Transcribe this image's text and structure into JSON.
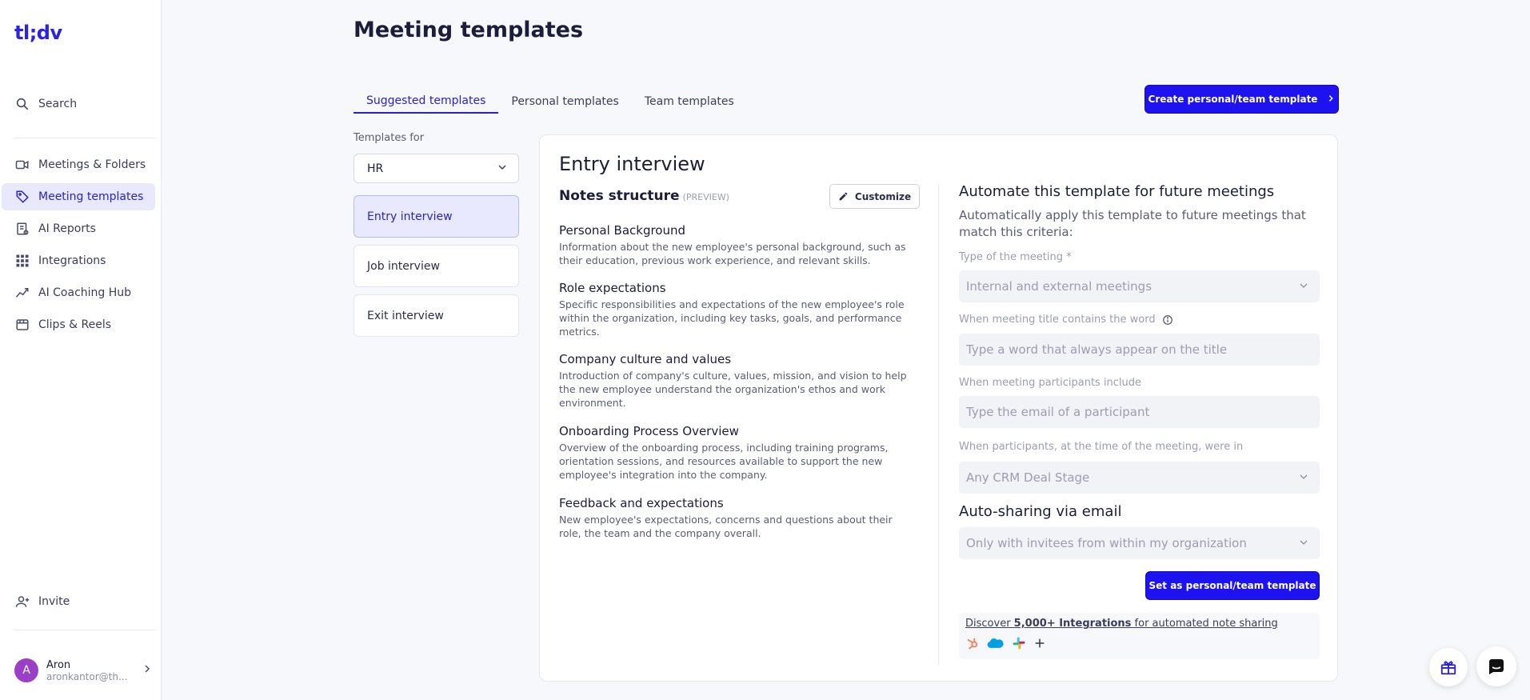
{
  "app": {
    "logo": "tl;dv"
  },
  "sidebar": {
    "search_label": "Search",
    "items": [
      {
        "label": "Meetings & Folders",
        "icon": "video-icon"
      },
      {
        "label": "Meeting templates",
        "icon": "template-tag-icon",
        "active": true
      },
      {
        "label": "AI Reports",
        "icon": "report-icon"
      },
      {
        "label": "Integrations",
        "icon": "grid-icon"
      },
      {
        "label": "AI Coaching Hub",
        "icon": "trend-icon"
      },
      {
        "label": "Clips & Reels",
        "icon": "clips-icon"
      }
    ],
    "invite_label": "Invite",
    "user": {
      "initial": "A",
      "name": "Aron",
      "email": "aronkantor@th..."
    }
  },
  "page": {
    "title": "Meeting templates",
    "tabs": [
      {
        "label": "Suggested templates",
        "active": true
      },
      {
        "label": "Personal templates"
      },
      {
        "label": "Team templates"
      }
    ],
    "create_button": "Create personal/team template",
    "templates_for_label": "Templates for",
    "templates_for_value": "HR",
    "templates": [
      {
        "label": "Entry interview",
        "active": true
      },
      {
        "label": "Job interview"
      },
      {
        "label": "Exit interview"
      }
    ]
  },
  "card": {
    "title": "Entry interview",
    "notes_title": "Notes structure",
    "preview_tag": "(PREVIEW)",
    "customize_label": "Customize",
    "sections": [
      {
        "title": "Personal Background",
        "desc": "Information about the new employee's personal background, such as their education, previous work experience, and relevant skills."
      },
      {
        "title": "Role expectations",
        "desc": "Specific responsibilities and expectations of the new employee's role within the organization, including key tasks, goals, and performance metrics."
      },
      {
        "title": "Company culture and values",
        "desc": "Introduction of company's culture, values, mission, and vision to help the new employee understand the organization's ethos and work environment."
      },
      {
        "title": "Onboarding Process Overview",
        "desc": "Overview of the onboarding process, including training programs, orientation sessions, and resources available to support the new employee's integration into the company."
      },
      {
        "title": "Feedback and expectations",
        "desc": "New employee's expectations, concerns and questions about their role, the team and the company overall."
      }
    ],
    "automate": {
      "title": "Automate this template for future meetings",
      "desc": "Automatically apply this template to future meetings that match this criteria:",
      "type_label": "Type of the meeting *",
      "type_value": "Internal and external meetings",
      "title_word_label": "When meeting title contains the word",
      "title_word_placeholder": "Type a word that always appear on the title",
      "participants_label": "When meeting participants include",
      "participants_placeholder": "Type the email of a participant",
      "crm_label": "When participants, at the time of the meeting, were in",
      "crm_value": "Any CRM Deal Stage"
    },
    "sharing": {
      "title": "Auto-sharing via email",
      "value": "Only with invitees from within my organization"
    },
    "set_button": "Set as personal/team template",
    "discover": {
      "prefix": "Discover ",
      "bold": "5,000+ Integrations",
      "suffix": " for automated note sharing",
      "icons": [
        "hubspot-icon",
        "salesforce-icon",
        "slack-icon",
        "plus-icon"
      ]
    }
  },
  "colors": {
    "accent": "#1d13f0",
    "active_bg": "#e8e9ff",
    "avatar": "#9b3fc9"
  }
}
